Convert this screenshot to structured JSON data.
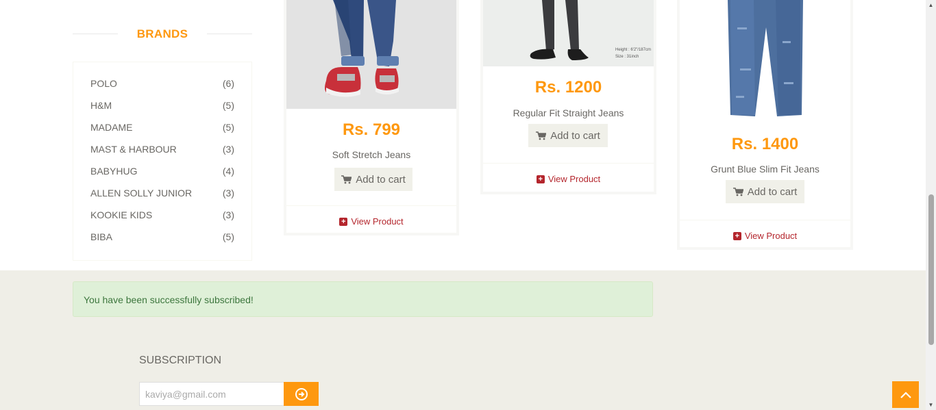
{
  "brands": {
    "title": "BRANDS",
    "items": [
      {
        "name": "POLO",
        "count": "(6)"
      },
      {
        "name": "H&M",
        "count": "(5)"
      },
      {
        "name": "MADAME",
        "count": "(5)"
      },
      {
        "name": "MAST & HARBOUR",
        "count": "(3)"
      },
      {
        "name": "BABYHUG",
        "count": "(4)"
      },
      {
        "name": "ALLEN SOLLY JUNIOR",
        "count": "(3)"
      },
      {
        "name": "KOOKIE KIDS",
        "count": "(3)"
      },
      {
        "name": "BIBA",
        "count": "(5)"
      }
    ]
  },
  "products": [
    {
      "price": "Rs. 799",
      "name": "Soft Stretch Jeans",
      "cart_label": "Add to cart",
      "view_label": "View Product"
    },
    {
      "price": "Rs. 1200",
      "name": "Regular Fit Straight Jeans",
      "cart_label": "Add to cart",
      "view_label": "View Product",
      "image_caption_1": "Height : 6'2\"/187cm",
      "image_caption_2": "Size : 31inch"
    },
    {
      "price": "Rs. 1400",
      "name": "Grunt Blue Slim Fit Jeans",
      "cart_label": "Add to cart",
      "view_label": "View Product"
    }
  ],
  "alert": {
    "message": "You have been successfully subscribed!"
  },
  "subscription": {
    "title": "SUBSCRIPTION",
    "email_value": "kaviya@gmail.com"
  },
  "colors": {
    "accent": "#fe980f",
    "link": "#b4262d",
    "footer_bg": "#efeee7",
    "success_bg": "#dff0d8"
  }
}
